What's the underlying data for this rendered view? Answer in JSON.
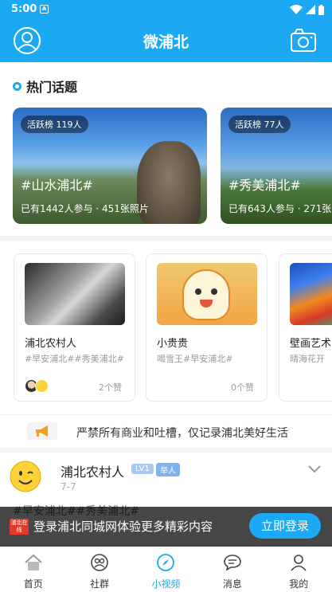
{
  "status_bar": {
    "time": "5:00",
    "notif_glyph": "A",
    "icons": [
      "wifi-icon",
      "signal-icon",
      "battery-icon"
    ]
  },
  "app_bar": {
    "title": "微浦北",
    "left_icon": "user-icon",
    "right_icon": "camera-icon"
  },
  "hot_topics": {
    "title": "热门话题",
    "cards": [
      {
        "badge": "活跃榜 119人",
        "name": "#山水浦北#",
        "stats": "已有1442人参与 · 451张照片"
      },
      {
        "badge": "活跃榜 77人",
        "name": "#秀美浦北#",
        "stats": "已有643人参与 · 271张"
      }
    ]
  },
  "videos": [
    {
      "name": "浦北农村人",
      "tags": "#早安浦北##秀美浦北#",
      "likes": "2个赞"
    },
    {
      "name": "小贵贵",
      "tags": "喝雪王#早安浦北#",
      "likes": "0个赞"
    },
    {
      "name": "壁画艺术",
      "tags": "晴海花开"
    }
  ],
  "notice": {
    "text": "严禁所有商业和吐槽，仅记录浦北美好生活"
  },
  "post": {
    "author": "浦北农村人",
    "level": "LV1",
    "rank": "举人",
    "date": "7-7",
    "tags": "#早安浦北##秀美浦北#"
  },
  "login_banner": {
    "logo_text": "浦北在线",
    "text": "登录浦北同城网体验更多精彩内容",
    "button": "立即登录"
  },
  "bottom_nav": {
    "active": "小视频",
    "items": [
      {
        "label": "首页",
        "icon": "home-icon"
      },
      {
        "label": "社群",
        "icon": "community-icon"
      },
      {
        "label": "小视频",
        "icon": "compass-icon"
      },
      {
        "label": "消息",
        "icon": "message-icon"
      },
      {
        "label": "我的",
        "icon": "profile-icon"
      }
    ]
  },
  "colors": {
    "primary": "#1aa9f2",
    "tag_gray": "#999999"
  }
}
